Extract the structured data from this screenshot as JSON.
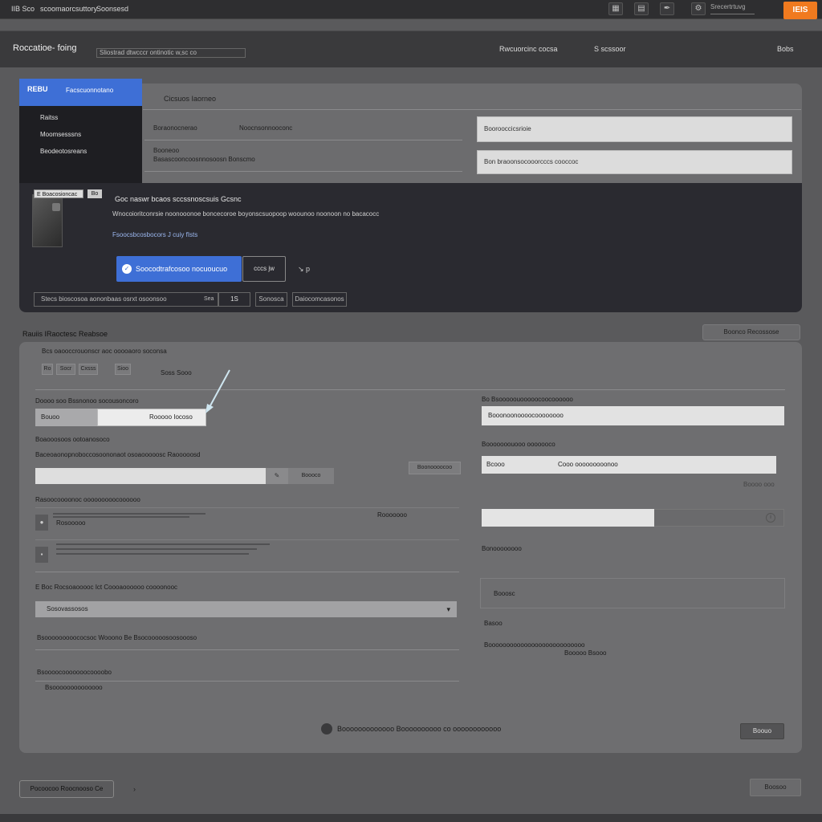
{
  "topbar": {
    "app_name": "IIB Sco",
    "subtitle": "scoomaorcsuttory",
    "menu": "Soonsesd",
    "field": "Srecertrtuvg",
    "orange_label": "IEIS",
    "icons": [
      "grid-icon",
      "table-icon",
      "wrench-icon",
      "settings-icon"
    ]
  },
  "header": {
    "title": "Roccatioe- foing",
    "tag": "Sliostrad dtwcccr ontinotic w,sc co",
    "link1": "Rwcuorcinc cocsa",
    "link2": "S scssoor",
    "link3": "Bobs"
  },
  "sidebar": {
    "active_short": "REBU",
    "active_label": "Facscuonnotano",
    "items": [
      "Raitss",
      "Moomsesssns",
      "Beodeotosreans"
    ]
  },
  "upper": {
    "tab_label": "Cicsuos Iaorneo",
    "row1_a": "Boraonocnerao",
    "row1_b": "Noocnsonnooconc",
    "row2_a": "Booneoo",
    "row2_b": "Basascooncoosnnosoosn Bonscmo",
    "right_input1": "Boorooccicsrioie",
    "right_input2": "Bon braoonsocooorcccs cooccoc"
  },
  "promo": {
    "badge": "E Boacosioncac",
    "badge2": "Bo",
    "title": "Goc naswr bcaos sccssnoscsuis Gcsnc",
    "description": "Wnocoioritconrsie noonooonoe boncecoroe boyonscsuopoop woounoo noonoon no bacacocc",
    "link": "Fsoocsbcosbocors J cuiy fIsts",
    "cta": "Soocodtrafcosoo nocuoucuo",
    "secondary": "cccs jw",
    "arrow": "↘ p",
    "bar": "Stecs  bioscosoa  aononbaas osrxt osoonsoo",
    "bar_suffix": "Sea",
    "page": "1S",
    "btn1": "Sonosca",
    "btn2": "Daiocomcasonos"
  },
  "section": {
    "label": "Rauiis IRaoctesc Reabsoe",
    "button": "Boonco  Recossose"
  },
  "form": {
    "header": "Bcs oaooccrouonscr aoc ooooaoro soconsa",
    "mini": [
      "Ro",
      "Socr",
      "Cxsss",
      "Sioo"
    ],
    "mini_text": "Soss Sooo",
    "left_label1": "Doooo soo Bssnonoo socousoncoro",
    "left_field_label": "Bouoo",
    "left_field_value": "Rooooo Iocoso",
    "left_label2": "Boaooosoos ootoanosoco",
    "left_label3": "Baceoaonopnoboccosoononaot osoaooooosc Raooooosd",
    "bar_btn2": "Boooco",
    "bar_btn3": "Boonoooocoo",
    "list_header": "Rasoocoooonoc ooooooooocoooooo",
    "list_row1_sub": "Rosooooo",
    "list_row1_right": "Rooooooo",
    "dropdown_label": "E  Boc  Rocsoaooooc  Ict  Coooaoooooo coooonooc",
    "dropdown_value": "Sosovassosos",
    "check_label": "Bsooooooooococsoc  Wooono  Be  Bsocooooosoosoooso",
    "bottom_label": "Bsoooocooooooocoooobo",
    "bottom_sub": "Bsoooooooooooooo",
    "right_label1": "Bo Bsooooouooooocoocoooooo",
    "right_input1": "Booonoonoooocoooooooo",
    "right_label2": "Booooooouooo ooooooco",
    "right_input2_label": "Bcooo",
    "right_input2_value": "Cooo ooooooooonoo",
    "right_hint": "Boooo ooo",
    "right_label3": "Bonoooooooo",
    "right_box": "Booosc",
    "right_small1": "Basoo",
    "right_small2": "Booooooooooooooooooooooooooo",
    "right_small3": "Booooo Bsooo",
    "progress_fraction": 0.57,
    "action": "Booooooooooooo  Boooooooooo co oooooooooooo",
    "action_btn": "Boouo"
  },
  "footer": {
    "left_button": "Pocoocoo Roocnooso Ce",
    "arrow": "›",
    "right_button": "Boosoo"
  },
  "colors": {
    "accent_blue": "#3e6fd6",
    "accent_orange": "#f07a1f",
    "panel": "#6e6e70",
    "dark_band": "#2a2a30"
  }
}
